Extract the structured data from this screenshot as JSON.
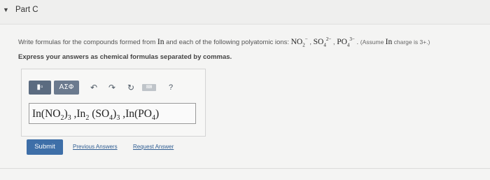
{
  "header": {
    "part_title": "Part C",
    "toggle_icon": "triangle-down-icon"
  },
  "question": {
    "text_before": "Write formulas for the compounds formed from ",
    "element": "In",
    "text_middle": " and each of the following polyatomic ions: ",
    "ion1": "NO",
    "ion1_sub": "2",
    "ion1_sup": "−",
    "ion2": "SO",
    "ion2_sub": "4",
    "ion2_sup": "2−",
    "ion3": "PO",
    "ion3_sub": "4",
    "ion3_sup": "3−",
    "note_before": "(Assume ",
    "note_element": "In",
    "note_after": " charge is 3+.)"
  },
  "instruction": "Express your answers as chemical formulas separated by commas.",
  "toolbar": {
    "template_label": "▮▫",
    "greek_label": "ΑΣΦ",
    "undo_icon": "↶",
    "redo_icon": "↷",
    "reset_icon": "↻",
    "keyboard_label": "⌨",
    "help_label": "?"
  },
  "answer": {
    "p1": "In(NO",
    "p1_sub": "2",
    "p1_close": ")",
    "p1_sub2": "3",
    "sep1": " ,",
    "p2": "In",
    "p2_sub": "2",
    "p2_open": " (SO",
    "p2_sub3": "4",
    "p2_close": ")",
    "p2_sub4": "3",
    "sep2": " ,",
    "p3": "In(PO",
    "p3_sub": "4",
    "p3_close": ")"
  },
  "actions": {
    "submit_label": "Submit",
    "previous_answers_label": "Previous Answers",
    "request_answer_label": "Request Answer"
  },
  "colors": {
    "submit_bg": "#3e6fa8",
    "link": "#2f5d92",
    "toolbar_button": "#5b6b80"
  }
}
